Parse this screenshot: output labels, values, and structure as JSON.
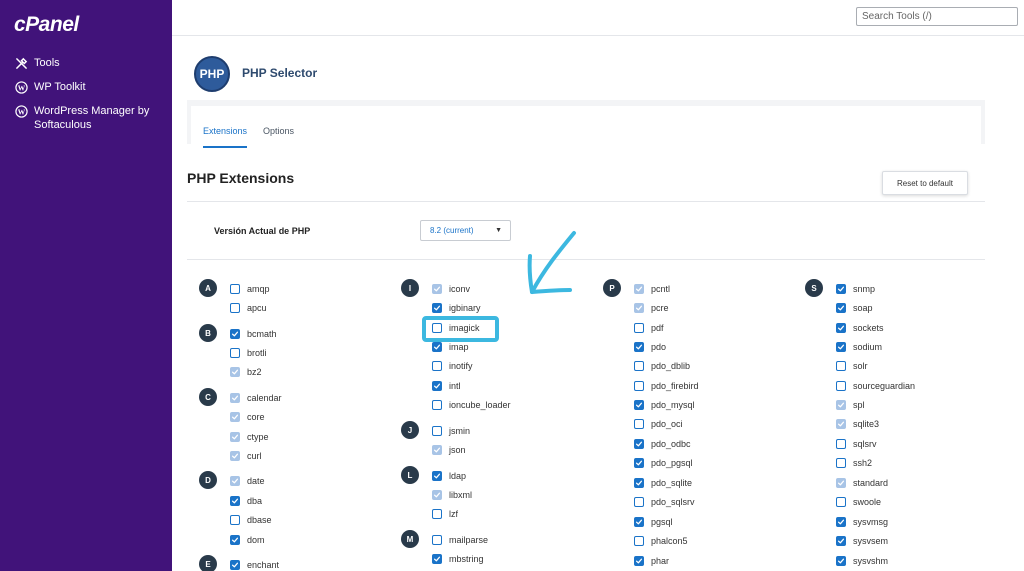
{
  "sidebar": {
    "logo": "cPanel",
    "items": [
      {
        "label": "Tools",
        "icon": "tools-icon"
      },
      {
        "label": "WP Toolkit",
        "icon": "wordpress-icon"
      },
      {
        "label": "WordPress Manager by Softaculous",
        "icon": "wordpress-icon"
      }
    ]
  },
  "topbar": {
    "search_placeholder": "Search Tools (/)"
  },
  "header": {
    "logo_text": "PHP",
    "title": "PHP Selector"
  },
  "tabs": [
    {
      "label": "Extensions",
      "active": true
    },
    {
      "label": "Options",
      "active": false
    }
  ],
  "section": {
    "title": "PHP Extensions",
    "reset_label": "Reset to default"
  },
  "version": {
    "label": "Versión Actual de PHP",
    "selected": "8.2 (current)"
  },
  "colors": {
    "sidebar": "#41137a",
    "accent": "#1a73c8",
    "badge": "#293a4a",
    "annotation": "#3cb8e0"
  },
  "letters": [
    "A",
    "B",
    "C",
    "D",
    "E",
    "I",
    "J",
    "L",
    "M",
    "P",
    "S"
  ],
  "extensions": [
    {
      "name": "amqp",
      "state": "unchecked"
    },
    {
      "name": "apcu",
      "state": "unchecked"
    },
    {
      "name": "bcmath",
      "state": "checked"
    },
    {
      "name": "brotli",
      "state": "unchecked"
    },
    {
      "name": "bz2",
      "state": "disabled"
    },
    {
      "name": "calendar",
      "state": "disabled"
    },
    {
      "name": "core",
      "state": "disabled"
    },
    {
      "name": "ctype",
      "state": "disabled"
    },
    {
      "name": "curl",
      "state": "disabled"
    },
    {
      "name": "date",
      "state": "disabled"
    },
    {
      "name": "dba",
      "state": "checked"
    },
    {
      "name": "dbase",
      "state": "unchecked"
    },
    {
      "name": "dom",
      "state": "checked"
    },
    {
      "name": "enchant",
      "state": "checked"
    },
    {
      "name": "iconv",
      "state": "disabled"
    },
    {
      "name": "igbinary",
      "state": "checked"
    },
    {
      "name": "imagick",
      "state": "unchecked"
    },
    {
      "name": "imap",
      "state": "checked"
    },
    {
      "name": "inotify",
      "state": "unchecked"
    },
    {
      "name": "intl",
      "state": "checked"
    },
    {
      "name": "ioncube_loader",
      "state": "unchecked"
    },
    {
      "name": "jsmin",
      "state": "unchecked"
    },
    {
      "name": "json",
      "state": "disabled"
    },
    {
      "name": "ldap",
      "state": "checked"
    },
    {
      "name": "libxml",
      "state": "disabled"
    },
    {
      "name": "lzf",
      "state": "unchecked"
    },
    {
      "name": "mailparse",
      "state": "unchecked"
    },
    {
      "name": "mbstring",
      "state": "checked"
    },
    {
      "name": "pcntl",
      "state": "disabled"
    },
    {
      "name": "pcre",
      "state": "disabled"
    },
    {
      "name": "pdf",
      "state": "unchecked"
    },
    {
      "name": "pdo",
      "state": "checked"
    },
    {
      "name": "pdo_dblib",
      "state": "unchecked"
    },
    {
      "name": "pdo_firebird",
      "state": "unchecked"
    },
    {
      "name": "pdo_mysql",
      "state": "checked"
    },
    {
      "name": "pdo_oci",
      "state": "unchecked"
    },
    {
      "name": "pdo_odbc",
      "state": "checked"
    },
    {
      "name": "pdo_pgsql",
      "state": "checked"
    },
    {
      "name": "pdo_sqlite",
      "state": "checked"
    },
    {
      "name": "pdo_sqlsrv",
      "state": "unchecked"
    },
    {
      "name": "pgsql",
      "state": "checked"
    },
    {
      "name": "phalcon5",
      "state": "unchecked"
    },
    {
      "name": "phar",
      "state": "checked"
    },
    {
      "name": "snmp",
      "state": "checked"
    },
    {
      "name": "soap",
      "state": "checked"
    },
    {
      "name": "sockets",
      "state": "checked"
    },
    {
      "name": "sodium",
      "state": "checked"
    },
    {
      "name": "solr",
      "state": "unchecked"
    },
    {
      "name": "sourceguardian",
      "state": "unchecked"
    },
    {
      "name": "spl",
      "state": "disabled"
    },
    {
      "name": "sqlite3",
      "state": "disabled"
    },
    {
      "name": "sqlsrv",
      "state": "unchecked"
    },
    {
      "name": "ssh2",
      "state": "unchecked"
    },
    {
      "name": "standard",
      "state": "disabled"
    },
    {
      "name": "swoole",
      "state": "unchecked"
    },
    {
      "name": "sysvmsg",
      "state": "checked"
    },
    {
      "name": "sysvsem",
      "state": "checked"
    },
    {
      "name": "sysvshm",
      "state": "checked"
    }
  ]
}
